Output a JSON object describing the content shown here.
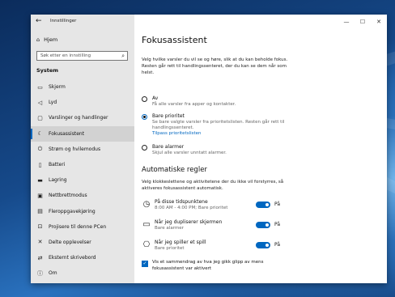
{
  "app": {
    "title": "Innstillinger"
  },
  "sidebar": {
    "home_label": "Hjem",
    "search_placeholder": "Søk etter en innstilling",
    "section": "System",
    "items": [
      {
        "label": "Skjerm",
        "icon": "monitor-icon"
      },
      {
        "label": "Lyd",
        "icon": "speaker-icon"
      },
      {
        "label": "Varslinger og handlinger",
        "icon": "notification-icon"
      },
      {
        "label": "Fokusassistent",
        "icon": "moon-icon",
        "active": true
      },
      {
        "label": "Strøm og hvilemodus",
        "icon": "power-icon"
      },
      {
        "label": "Batteri",
        "icon": "battery-icon"
      },
      {
        "label": "Lagring",
        "icon": "storage-icon"
      },
      {
        "label": "Nettbrettmodus",
        "icon": "tablet-icon"
      },
      {
        "label": "Fleroppgavekjøring",
        "icon": "multitask-icon"
      },
      {
        "label": "Projisere til denne PCen",
        "icon": "project-icon"
      },
      {
        "label": "Delte opplevelser",
        "icon": "share-icon"
      },
      {
        "label": "Eksternt skrivebord",
        "icon": "remote-icon"
      },
      {
        "label": "Om",
        "icon": "info-icon"
      }
    ]
  },
  "main": {
    "title": "Fokusassistent",
    "intro": "Velg hvilke varsler du vil se og høre, slik at du kan beholde fokus. Resten går rett til handlingssenteret, der du kan se dem når som helst.",
    "options": [
      {
        "title": "Av",
        "desc": "Få alle varsler fra apper og kontakter.",
        "selected": false
      },
      {
        "title": "Bare prioritet",
        "desc": "Se bare valgte varsler fra prioritetslisten. Resten går rett til handlingssenteret.",
        "link": "Tilpass prioritetslisten",
        "selected": true
      },
      {
        "title": "Bare alarmer",
        "desc": "Skjul alle varsler unntatt alarmer.",
        "selected": false
      }
    ],
    "rules_heading": "Automatiske regler",
    "rules_intro": "Velg klokkeslettene og aktivitetene der du ikke vil forstyrres, så aktiveres fokusassistent automatisk.",
    "rules": [
      {
        "title": "På disse tidspunktene",
        "sub": "8:00 AM - 4:00 PM; Bare prioritet",
        "icon": "clock-icon",
        "state": "På"
      },
      {
        "title": "Når jeg dupliserer skjermen",
        "sub": "Bare alarmer",
        "icon": "display-icon",
        "state": "På"
      },
      {
        "title": "Når jeg spiller et spill",
        "sub": "Bare prioritet",
        "icon": "gamepad-icon",
        "state": "På"
      }
    ],
    "summary_checkbox": "Vis et sammendrag av hva jeg gikk glipp av mens fokusassistent var aktivert"
  },
  "colors": {
    "accent": "#0067c0",
    "sidebar_bg": "#e6e6e6"
  }
}
